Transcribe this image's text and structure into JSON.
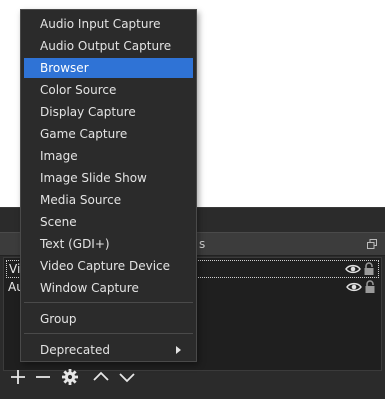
{
  "colors": {
    "menu_bg": "#2b2b2b",
    "highlight": "#2f73d6",
    "dock_bg": "#2b2b2b",
    "titlebar_bg": "#3c3c3c",
    "list_bg": "#1f1f1f",
    "text": "#e3e3e3"
  },
  "dock": {
    "title_fragment": "s",
    "sources": [
      {
        "label": "Vic",
        "selected": true
      },
      {
        "label": "Au",
        "selected": false
      }
    ],
    "toolbar_icons": [
      "plus-icon",
      "minus-icon",
      "gear-icon",
      "chevron-up-icon",
      "chevron-down-icon"
    ]
  },
  "menu": {
    "items": [
      {
        "label": "Audio Input Capture"
      },
      {
        "label": "Audio Output Capture"
      },
      {
        "label": "Browser",
        "highlighted": true
      },
      {
        "label": "Color Source"
      },
      {
        "label": "Display Capture"
      },
      {
        "label": "Game Capture"
      },
      {
        "label": "Image"
      },
      {
        "label": "Image Slide Show"
      },
      {
        "label": "Media Source"
      },
      {
        "label": "Scene"
      },
      {
        "label": "Text (GDI+)"
      },
      {
        "label": "Video Capture Device"
      },
      {
        "label": "Window Capture"
      }
    ],
    "group_label": "Group",
    "deprecated_label": "Deprecated"
  }
}
